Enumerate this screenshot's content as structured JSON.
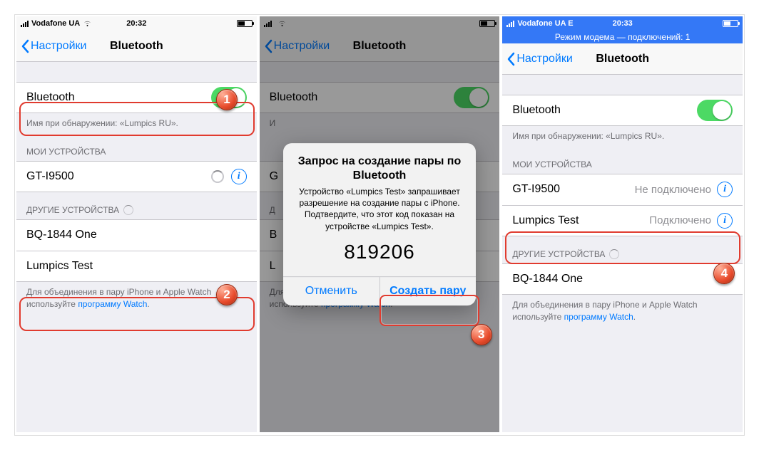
{
  "screen1": {
    "carrier": "Vodafone UA",
    "time": "20:32",
    "back": "Настройки",
    "title": "Bluetooth",
    "toggle_label": "Bluetooth",
    "discoverable": "Имя при обнаружении: «Lumpics RU».",
    "my_header": "МОИ УСТРОЙСТВА",
    "my_device": "GT-I9500",
    "other_header": "ДРУГИЕ УСТРОЙСТВА",
    "other1": "BQ-1844 One",
    "other2": "Lumpics Test",
    "foot_a": "Для объединения в пару iPhone и Apple Watch используйте ",
    "foot_link": "программу Watch",
    "marker1": "1",
    "marker2": "2"
  },
  "screen2": {
    "carrier": " ",
    "time": " ",
    "back": "Настройки",
    "title": "Bluetooth",
    "toggle_label": "Bluetooth",
    "alert_title": "Запрос на создание пары по Bluetooth",
    "alert_msg": "Устройство «Lumpics Test» запрашивает разрешение на создание пары с iPhone. Подтвердите, что этот код показан на устройстве «Lumpics Test».",
    "alert_code": "819206",
    "alert_cancel": "Отменить",
    "alert_pair": "Создать пару",
    "foot_a": "Для объединения в пару iPhone и Apple Watch используйте ",
    "foot_link": "программу Watch",
    "row_g": "G",
    "row_b": "B",
    "row_l": "L",
    "marker3": "3"
  },
  "screen3": {
    "carrier": "Vodafone UA  E",
    "time": "20:33",
    "hotspot": "Режим модема — подключений: 1",
    "back": "Настройки",
    "title": "Bluetooth",
    "toggle_label": "Bluetooth",
    "discoverable": "Имя при обнаружении: «Lumpics RU».",
    "my_header": "МОИ УСТРОЙСТВА",
    "dev1_name": "GT-I9500",
    "dev1_status": "Не подключено",
    "dev2_name": "Lumpics Test",
    "dev2_status": "Подключено",
    "other_header": "ДРУГИЕ УСТРОЙСТВА",
    "other1": "BQ-1844 One",
    "foot_a": "Для объединения в пару iPhone и Apple Watch используйте ",
    "foot_link": "программу Watch",
    "marker4": "4"
  }
}
